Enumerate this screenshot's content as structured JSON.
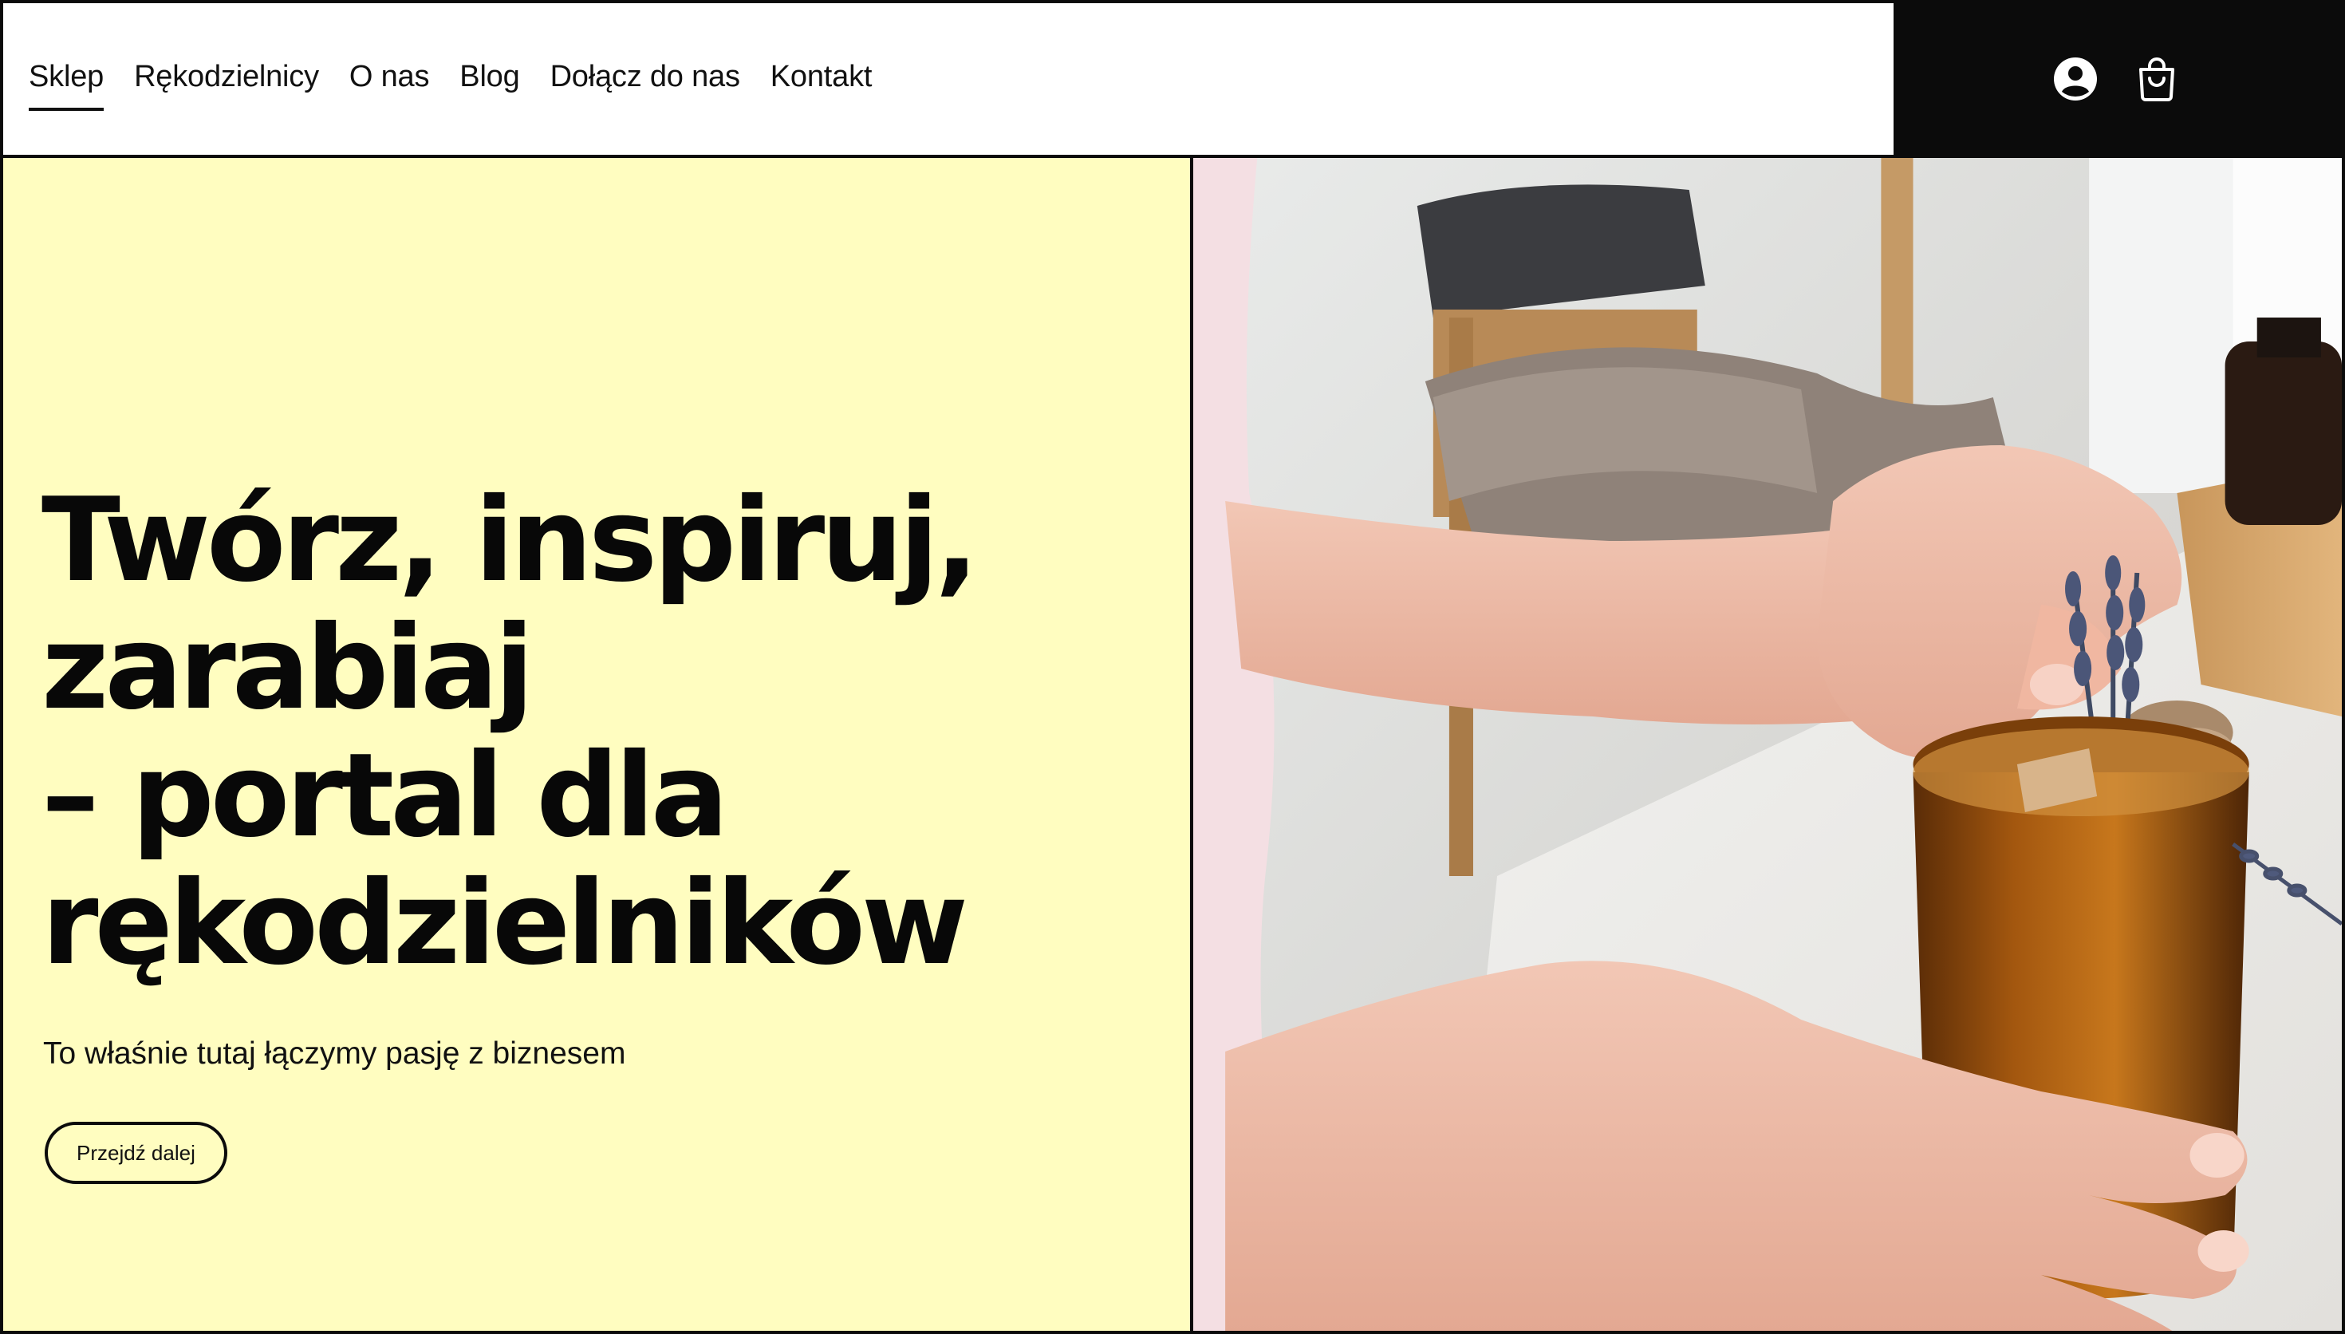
{
  "nav": {
    "items": [
      {
        "label": "Sklep",
        "active": true
      },
      {
        "label": "Rękodzielnicy",
        "active": false
      },
      {
        "label": "O nas",
        "active": false
      },
      {
        "label": "Blog",
        "active": false
      },
      {
        "label": "Dołącz do nas",
        "active": false
      },
      {
        "label": "Kontakt",
        "active": false
      }
    ]
  },
  "header_actions": {
    "icons": [
      "user-account-icon",
      "shopping-bag-icon"
    ]
  },
  "hero": {
    "title": "Twórz, inspiruj,\nzarabiaj\n– portal dla\nrękodzielników",
    "subtitle": "To właśnie tutaj łączymy pasję z biznesem",
    "cta_label": "Przejdź dalej",
    "image_subject": "hands placing lavender into amber glass candle jar"
  },
  "colors": {
    "hero_background": "#fffdc0",
    "header_actions_background": "#0b0b0b",
    "text": "#0b0b0b",
    "border": "#0b0b0b"
  }
}
